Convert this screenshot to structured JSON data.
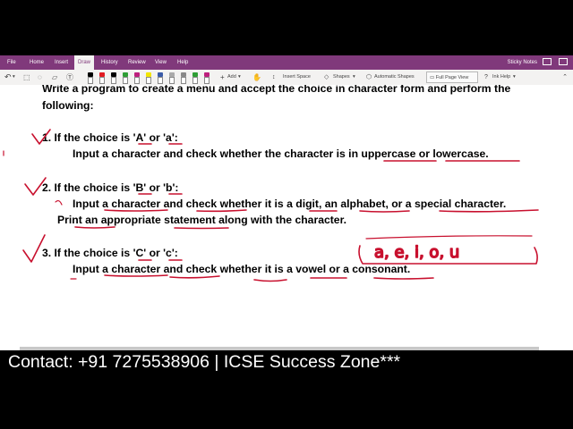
{
  "ribbon": {
    "tabs": [
      "File",
      "Home",
      "Insert",
      "Draw",
      "History",
      "Review",
      "View",
      "Help"
    ],
    "active_tab": "Draw",
    "right_label": "Sticky Notes",
    "accent": "#80397b"
  },
  "toolbar": {
    "add_label": "Add",
    "insert_space_label": "Insert Space",
    "shapes_label": "Shapes",
    "automatic_shapes_label": "Automatic Shapes",
    "full_page_view_label": "Full Page View",
    "ink_help_label": "Ink Help",
    "pen_colors": [
      "#000000",
      "#e11b22",
      "#000000",
      "#2e9e34",
      "#bd1f7d",
      "#f2e600",
      "#3a5ba8",
      "#aaaaaa",
      "#888888",
      "#2e9e34",
      "#bd1f7d"
    ]
  },
  "page": {
    "intro_line1": "Write a program to create a menu and accept the choice in character form and perform the",
    "intro_line2": "following:",
    "item1_title": "1. If the choice is 'A' or 'a':",
    "item1_body": "Input a character and check whether the character is in uppercase or lowercase.",
    "item2_title": "2. If the choice is 'B' or 'b':",
    "item2_body": "Input a character and check whether it is a digit, an alphabet, or a special character.",
    "item2_body2": "Print an appropriate statement along with the character.",
    "item3_title": "3. If the choice is 'C' or 'c':",
    "item3_body": "Input a character and check whether it is a vowel or a consonant.",
    "ink_note": "a, e, i, o, u",
    "ink_color": "#c8102e"
  },
  "footer": {
    "text": "Contact:  +91 7275538906 | ICSE Success Zone***"
  }
}
